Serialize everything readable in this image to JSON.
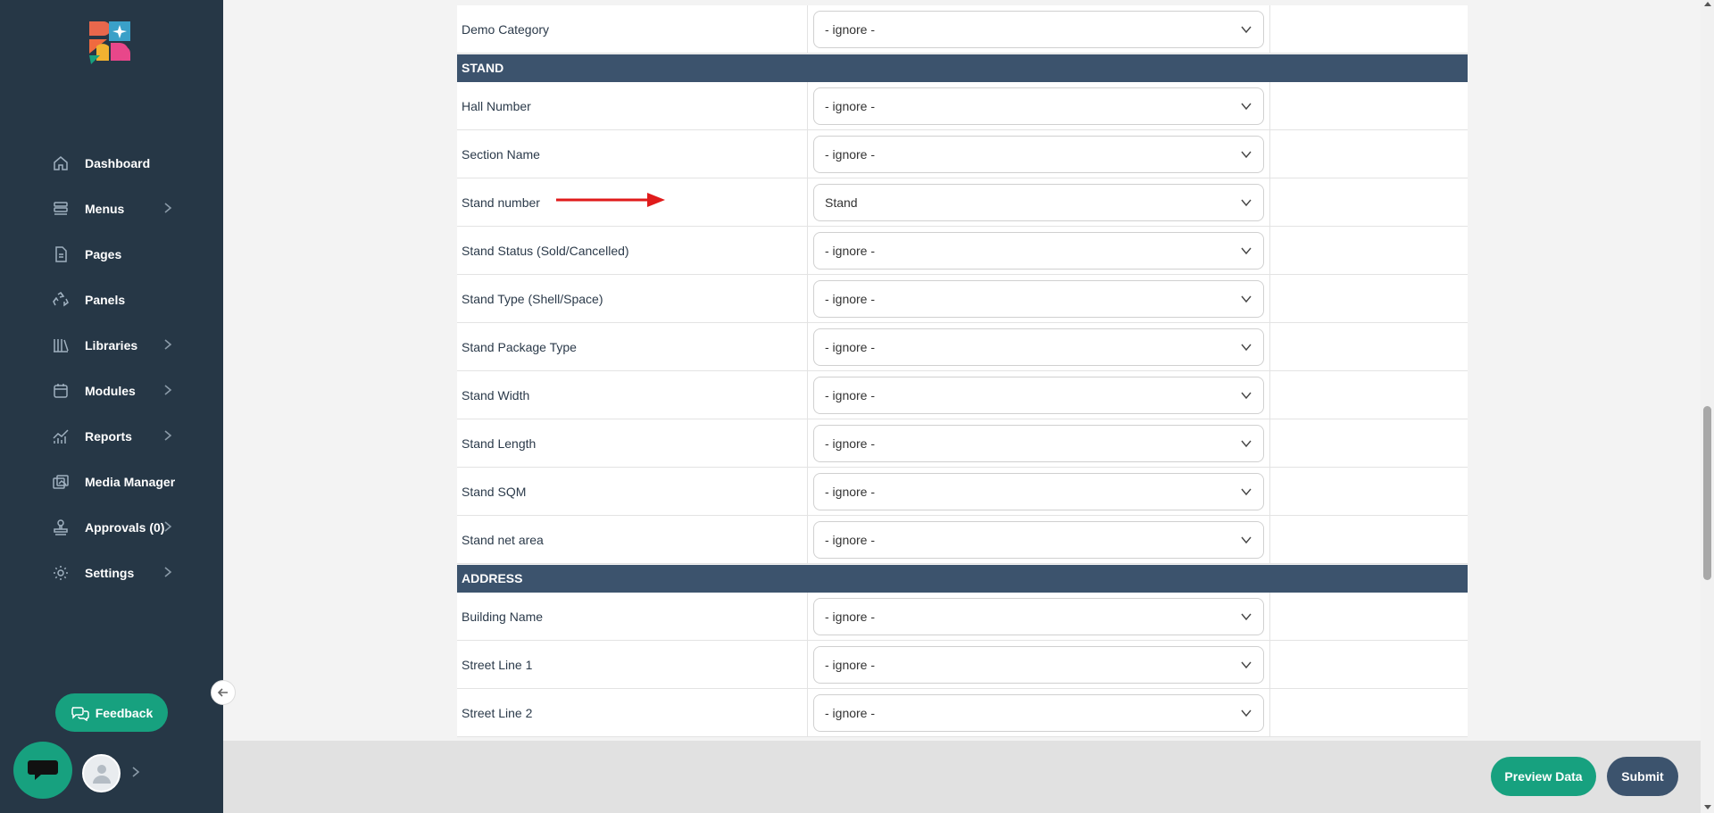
{
  "sidebar": {
    "items": [
      {
        "label": "Dashboard",
        "icon": "home-icon",
        "has_submenu": false
      },
      {
        "label": "Menus",
        "icon": "menu-icon",
        "has_submenu": true
      },
      {
        "label": "Pages",
        "icon": "page-icon",
        "has_submenu": false
      },
      {
        "label": "Panels",
        "icon": "recycle-icon",
        "has_submenu": false
      },
      {
        "label": "Libraries",
        "icon": "library-icon",
        "has_submenu": true
      },
      {
        "label": "Modules",
        "icon": "calendar-icon",
        "has_submenu": true
      },
      {
        "label": "Reports",
        "icon": "chart-icon",
        "has_submenu": true
      },
      {
        "label": "Media Manager",
        "icon": "image-icon",
        "has_submenu": false
      },
      {
        "label": "Approvals (0)",
        "icon": "stamp-icon",
        "has_submenu": true
      },
      {
        "label": "Settings",
        "icon": "gear-icon",
        "has_submenu": true
      }
    ],
    "feedback_label": "Feedback"
  },
  "mapping": {
    "rows": [
      {
        "type": "row",
        "label": "Demo Category",
        "value": "- ignore -"
      },
      {
        "type": "section",
        "label": "STAND"
      },
      {
        "type": "row",
        "label": "Hall Number",
        "value": "- ignore -"
      },
      {
        "type": "row",
        "label": "Section Name",
        "value": "- ignore -"
      },
      {
        "type": "row",
        "label": "Stand number",
        "value": "Stand"
      },
      {
        "type": "row",
        "label": "Stand Status (Sold/Cancelled)",
        "value": "- ignore -"
      },
      {
        "type": "row",
        "label": "Stand Type (Shell/Space)",
        "value": "- ignore -"
      },
      {
        "type": "row",
        "label": "Stand Package Type",
        "value": "- ignore -"
      },
      {
        "type": "row",
        "label": "Stand Width",
        "value": "- ignore -"
      },
      {
        "type": "row",
        "label": "Stand Length",
        "value": "- ignore -"
      },
      {
        "type": "row",
        "label": "Stand SQM",
        "value": "- ignore -"
      },
      {
        "type": "row",
        "label": "Stand net area",
        "value": "- ignore -"
      },
      {
        "type": "section",
        "label": "ADDRESS"
      },
      {
        "type": "row",
        "label": "Building Name",
        "value": "- ignore -"
      },
      {
        "type": "row",
        "label": "Street Line 1",
        "value": "- ignore -"
      },
      {
        "type": "row",
        "label": "Street Line 2",
        "value": "- ignore -"
      }
    ]
  },
  "footer": {
    "preview_label": "Preview Data",
    "submit_label": "Submit"
  },
  "colors": {
    "sidebar_bg": "#263746",
    "accent": "#17a17f",
    "section_header": "#3c536d",
    "annotation_arrow": "#e01b1b"
  }
}
